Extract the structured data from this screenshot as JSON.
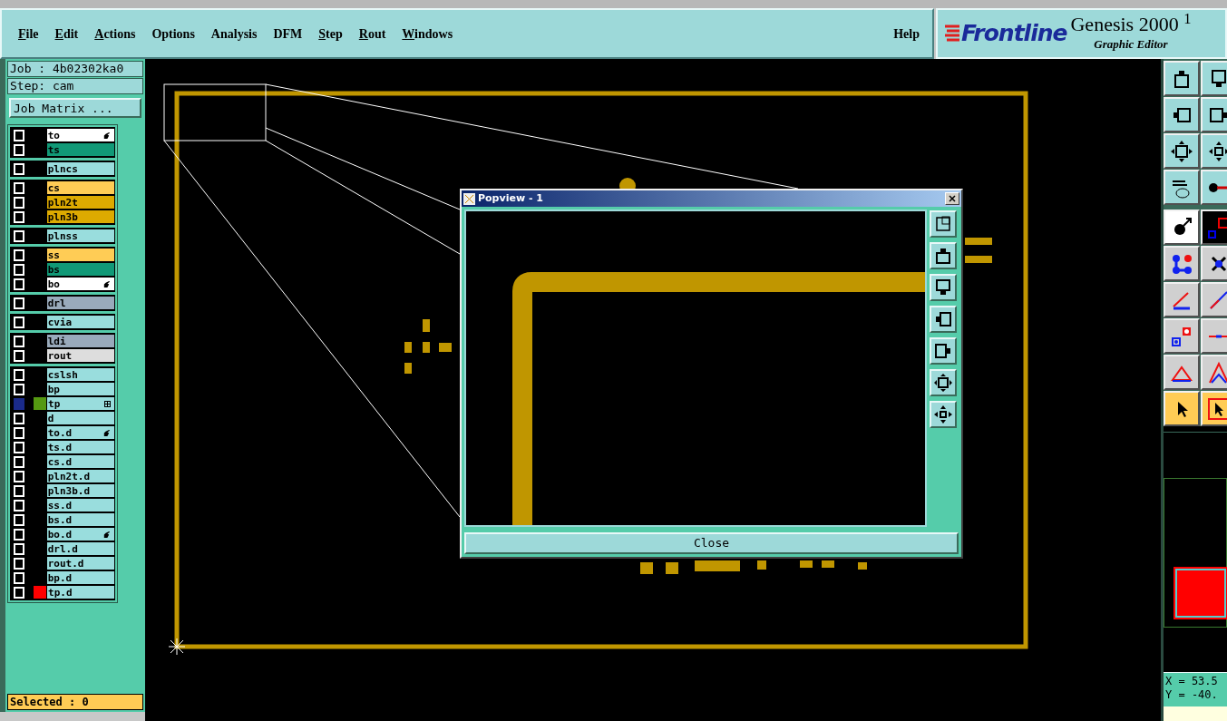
{
  "menu": [
    {
      "label": "File",
      "underlined": true
    },
    {
      "label": "Edit",
      "underlined": true
    },
    {
      "label": "Actions",
      "underlined": true
    },
    {
      "label": "Options",
      "underlined": false
    },
    {
      "label": "Analysis",
      "underlined": false
    },
    {
      "label": "DFM",
      "underlined": false
    },
    {
      "label": "Step",
      "underlined": true
    },
    {
      "label": "Rout",
      "underlined": true
    },
    {
      "label": "Windows",
      "underlined": true
    }
  ],
  "help": "Help",
  "logo": {
    "brand": "Frontline",
    "product": "Genesis 2000 $^{1}$",
    "subtitle": "Graphic Editor"
  },
  "job": "Job : 4b02302ka0",
  "step": "Step: cam",
  "job_matrix": "Job Matrix ...",
  "layer_groups": [
    [
      {
        "name": "to",
        "color": "#ffffff",
        "kind": "hand",
        "highlighted": false
      },
      {
        "name": "ts",
        "color": "#119977",
        "kind": "plain",
        "highlighted": false
      }
    ],
    [
      {
        "name": "plncs",
        "color": "#99dddd",
        "kind": "plain",
        "highlighted": false
      }
    ],
    [
      {
        "name": "cs",
        "color": "#ffcc55",
        "kind": "plain",
        "highlighted": false
      },
      {
        "name": "pln2t",
        "color": "#ddaa00",
        "kind": "plain",
        "highlighted": false
      },
      {
        "name": "pln3b",
        "color": "#ddaa00",
        "kind": "plain",
        "highlighted": false
      }
    ],
    [
      {
        "name": "plnss",
        "color": "#99dddd",
        "kind": "plain",
        "highlighted": false
      }
    ],
    [
      {
        "name": "ss",
        "color": "#ffcc55",
        "kind": "plain",
        "highlighted": false
      },
      {
        "name": "bs",
        "color": "#119977",
        "kind": "plain",
        "highlighted": false
      },
      {
        "name": "bo",
        "color": "#ffffff",
        "kind": "hand",
        "highlighted": false
      }
    ],
    [
      {
        "name": "drl",
        "color": "#99aabb",
        "kind": "plain",
        "highlighted": false
      }
    ],
    [
      {
        "name": "cvia",
        "color": "#99dddd",
        "kind": "plain",
        "highlighted": false
      }
    ],
    [
      {
        "name": "ldi",
        "color": "#99aabb",
        "kind": "plain",
        "highlighted": false
      },
      {
        "name": "rout",
        "color": "#dddddd",
        "kind": "plain",
        "highlighted": false
      }
    ],
    [
      {
        "name": "cslsh",
        "color": "#99dddd",
        "kind": "plain",
        "highlighted": false
      },
      {
        "name": "bp",
        "color": "#99dddd",
        "kind": "plain",
        "highlighted": false
      },
      {
        "name": "tp",
        "color": "#99dddd",
        "kind": "grid",
        "swatch": {
          "color": "#559911"
        },
        "highlighted": true
      },
      {
        "name": "d",
        "color": "#99dddd",
        "kind": "plain",
        "highlighted": false
      },
      {
        "name": "to.d",
        "color": "#99dddd",
        "kind": "hand",
        "highlighted": false
      },
      {
        "name": "ts.d",
        "color": "#99dddd",
        "kind": "plain",
        "highlighted": false
      },
      {
        "name": "cs.d",
        "color": "#99dddd",
        "kind": "plain",
        "highlighted": false
      },
      {
        "name": "pln2t.d",
        "color": "#99dddd",
        "kind": "plain",
        "highlighted": false
      },
      {
        "name": "pln3b.d",
        "color": "#99dddd",
        "kind": "plain",
        "highlighted": false
      },
      {
        "name": "ss.d",
        "color": "#99dddd",
        "kind": "plain",
        "highlighted": false
      },
      {
        "name": "bs.d",
        "color": "#99dddd",
        "kind": "plain",
        "highlighted": false
      },
      {
        "name": "bo.d",
        "color": "#99dddd",
        "kind": "hand",
        "highlighted": false
      },
      {
        "name": "drl.d",
        "color": "#99dddd",
        "kind": "plain",
        "highlighted": false
      },
      {
        "name": "rout.d",
        "color": "#99dddd",
        "kind": "plain",
        "highlighted": false
      },
      {
        "name": "bp.d",
        "color": "#99dddd",
        "kind": "plain",
        "highlighted": false
      },
      {
        "name": "tp.d",
        "color": "#99dddd",
        "kind": "plain",
        "swatch": {
          "color": "#ff0000"
        },
        "highlighted": false
      }
    ]
  ],
  "selected_count": "Selected : 0",
  "popview": {
    "title": "Popview - 1",
    "close_button": "Close"
  },
  "coords": {
    "x": "X = 53.5",
    "y": "Y = -40."
  }
}
